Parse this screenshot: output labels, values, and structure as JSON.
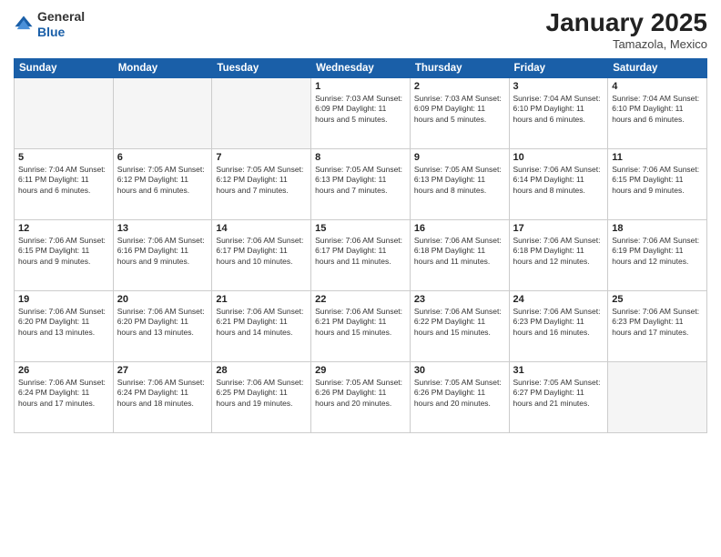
{
  "header": {
    "logo_line1": "General",
    "logo_line2": "Blue",
    "month": "January 2025",
    "location": "Tamazola, Mexico"
  },
  "weekdays": [
    "Sunday",
    "Monday",
    "Tuesday",
    "Wednesday",
    "Thursday",
    "Friday",
    "Saturday"
  ],
  "weeks": [
    [
      {
        "day": "",
        "info": ""
      },
      {
        "day": "",
        "info": ""
      },
      {
        "day": "",
        "info": ""
      },
      {
        "day": "1",
        "info": "Sunrise: 7:03 AM\nSunset: 6:09 PM\nDaylight: 11 hours\nand 5 minutes."
      },
      {
        "day": "2",
        "info": "Sunrise: 7:03 AM\nSunset: 6:09 PM\nDaylight: 11 hours\nand 5 minutes."
      },
      {
        "day": "3",
        "info": "Sunrise: 7:04 AM\nSunset: 6:10 PM\nDaylight: 11 hours\nand 6 minutes."
      },
      {
        "day": "4",
        "info": "Sunrise: 7:04 AM\nSunset: 6:10 PM\nDaylight: 11 hours\nand 6 minutes."
      }
    ],
    [
      {
        "day": "5",
        "info": "Sunrise: 7:04 AM\nSunset: 6:11 PM\nDaylight: 11 hours\nand 6 minutes."
      },
      {
        "day": "6",
        "info": "Sunrise: 7:05 AM\nSunset: 6:12 PM\nDaylight: 11 hours\nand 6 minutes."
      },
      {
        "day": "7",
        "info": "Sunrise: 7:05 AM\nSunset: 6:12 PM\nDaylight: 11 hours\nand 7 minutes."
      },
      {
        "day": "8",
        "info": "Sunrise: 7:05 AM\nSunset: 6:13 PM\nDaylight: 11 hours\nand 7 minutes."
      },
      {
        "day": "9",
        "info": "Sunrise: 7:05 AM\nSunset: 6:13 PM\nDaylight: 11 hours\nand 8 minutes."
      },
      {
        "day": "10",
        "info": "Sunrise: 7:06 AM\nSunset: 6:14 PM\nDaylight: 11 hours\nand 8 minutes."
      },
      {
        "day": "11",
        "info": "Sunrise: 7:06 AM\nSunset: 6:15 PM\nDaylight: 11 hours\nand 9 minutes."
      }
    ],
    [
      {
        "day": "12",
        "info": "Sunrise: 7:06 AM\nSunset: 6:15 PM\nDaylight: 11 hours\nand 9 minutes."
      },
      {
        "day": "13",
        "info": "Sunrise: 7:06 AM\nSunset: 6:16 PM\nDaylight: 11 hours\nand 9 minutes."
      },
      {
        "day": "14",
        "info": "Sunrise: 7:06 AM\nSunset: 6:17 PM\nDaylight: 11 hours\nand 10 minutes."
      },
      {
        "day": "15",
        "info": "Sunrise: 7:06 AM\nSunset: 6:17 PM\nDaylight: 11 hours\nand 11 minutes."
      },
      {
        "day": "16",
        "info": "Sunrise: 7:06 AM\nSunset: 6:18 PM\nDaylight: 11 hours\nand 11 minutes."
      },
      {
        "day": "17",
        "info": "Sunrise: 7:06 AM\nSunset: 6:18 PM\nDaylight: 11 hours\nand 12 minutes."
      },
      {
        "day": "18",
        "info": "Sunrise: 7:06 AM\nSunset: 6:19 PM\nDaylight: 11 hours\nand 12 minutes."
      }
    ],
    [
      {
        "day": "19",
        "info": "Sunrise: 7:06 AM\nSunset: 6:20 PM\nDaylight: 11 hours\nand 13 minutes."
      },
      {
        "day": "20",
        "info": "Sunrise: 7:06 AM\nSunset: 6:20 PM\nDaylight: 11 hours\nand 13 minutes."
      },
      {
        "day": "21",
        "info": "Sunrise: 7:06 AM\nSunset: 6:21 PM\nDaylight: 11 hours\nand 14 minutes."
      },
      {
        "day": "22",
        "info": "Sunrise: 7:06 AM\nSunset: 6:21 PM\nDaylight: 11 hours\nand 15 minutes."
      },
      {
        "day": "23",
        "info": "Sunrise: 7:06 AM\nSunset: 6:22 PM\nDaylight: 11 hours\nand 15 minutes."
      },
      {
        "day": "24",
        "info": "Sunrise: 7:06 AM\nSunset: 6:23 PM\nDaylight: 11 hours\nand 16 minutes."
      },
      {
        "day": "25",
        "info": "Sunrise: 7:06 AM\nSunset: 6:23 PM\nDaylight: 11 hours\nand 17 minutes."
      }
    ],
    [
      {
        "day": "26",
        "info": "Sunrise: 7:06 AM\nSunset: 6:24 PM\nDaylight: 11 hours\nand 17 minutes."
      },
      {
        "day": "27",
        "info": "Sunrise: 7:06 AM\nSunset: 6:24 PM\nDaylight: 11 hours\nand 18 minutes."
      },
      {
        "day": "28",
        "info": "Sunrise: 7:06 AM\nSunset: 6:25 PM\nDaylight: 11 hours\nand 19 minutes."
      },
      {
        "day": "29",
        "info": "Sunrise: 7:05 AM\nSunset: 6:26 PM\nDaylight: 11 hours\nand 20 minutes."
      },
      {
        "day": "30",
        "info": "Sunrise: 7:05 AM\nSunset: 6:26 PM\nDaylight: 11 hours\nand 20 minutes."
      },
      {
        "day": "31",
        "info": "Sunrise: 7:05 AM\nSunset: 6:27 PM\nDaylight: 11 hours\nand 21 minutes."
      },
      {
        "day": "",
        "info": ""
      }
    ]
  ]
}
